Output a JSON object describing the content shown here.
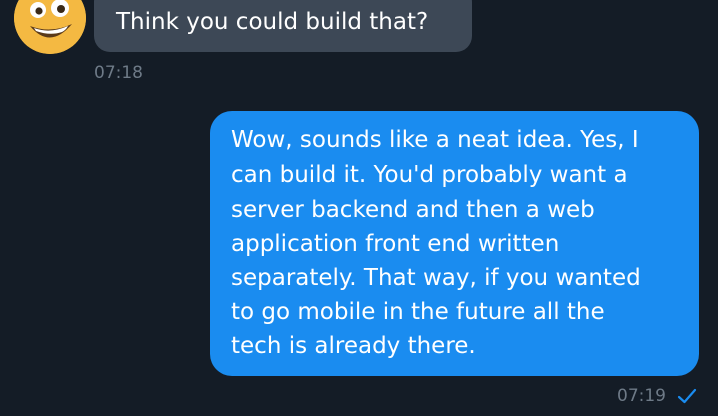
{
  "conversation": {
    "incoming": {
      "avatar_icon": "smiling-emoji-icon",
      "text": "Think you could build that?",
      "time": "07:18"
    },
    "outgoing": {
      "lines": [
        "Wow, sounds like a neat idea. Yes, I",
        "can build it. You'd probably want a",
        "server backend and then a web",
        "application front end written",
        "separately. That way, if you wanted",
        "to go mobile in the future all the",
        "tech is already there."
      ],
      "time": "07:19",
      "status_icon": "sent-check-icon"
    }
  },
  "colors": {
    "background": "#141c26",
    "incoming_bubble": "#3d4856",
    "outgoing_bubble": "#1a8cf0",
    "timestamp": "#6e7a87",
    "check": "#1a8cf0"
  }
}
